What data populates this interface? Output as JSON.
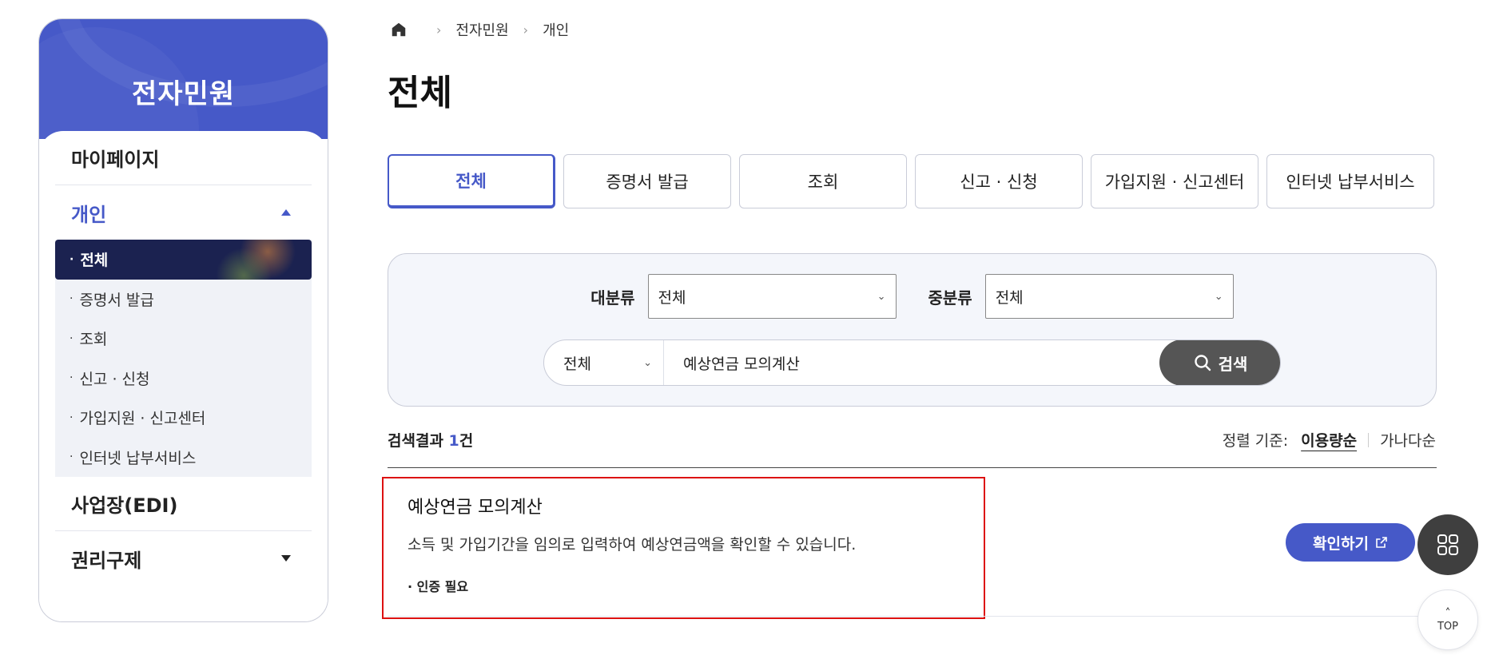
{
  "sidebar": {
    "title": "전자민원",
    "menus": {
      "mypage": "마이페이지",
      "personal": "개인",
      "business": "사업장(EDI)",
      "rights": "권리구제"
    },
    "sub_items": [
      "전체",
      "증명서 발급",
      "조회",
      "신고 · 신청",
      "가입지원 · 신고센터",
      "인터넷 납부서비스"
    ]
  },
  "breadcrumb": {
    "items": [
      "전자민원",
      "개인"
    ]
  },
  "page": {
    "title": "전체"
  },
  "tabs": [
    "전체",
    "증명서 발급",
    "조회",
    "신고 · 신청",
    "가입지원 · 신고센터",
    "인터넷 납부서비스"
  ],
  "search": {
    "major_label": "대분류",
    "major_value": "전체",
    "middle_label": "중분류",
    "middle_value": "전체",
    "query_type": "전체",
    "query_value": "예상연금 모의계산",
    "button_label": "검색"
  },
  "results": {
    "count_prefix": "검색결과 ",
    "count": "1",
    "count_suffix": "건",
    "sort_label": "정렬 기준:",
    "sort_options": [
      "이용량순",
      "가나다순"
    ],
    "items": [
      {
        "title": "예상연금 모의계산",
        "description": "소득 및 가입기간을 임의로 입력하여 예상연금액을 확인할 수 있습니다.",
        "tag": "· 인증 필요",
        "action": "확인하기"
      }
    ]
  },
  "floating": {
    "top_label": "TOP"
  },
  "colors": {
    "accent": "#4659c8",
    "sidebar_active": "#1b2250",
    "highlight_border": "#dd1111"
  }
}
